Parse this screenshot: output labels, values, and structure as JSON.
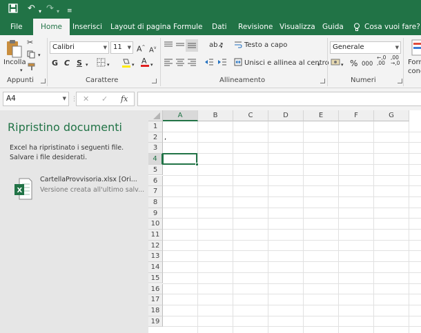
{
  "quick_access": {
    "save_icon": "save-icon",
    "undo_icon": "undo-icon",
    "redo_icon": "redo-icon",
    "customize_icon": "customize-qat-icon"
  },
  "tabs": [
    "File",
    "Home",
    "Inserisci",
    "Layout di pagina",
    "Formule",
    "Dati",
    "Revisione",
    "Visualizza",
    "Guida",
    "Cosa vuoi fare?"
  ],
  "active_tab": "Home",
  "ribbon": {
    "clipboard": {
      "paste_label": "Incolla",
      "group_label": "Appunti"
    },
    "font": {
      "font_name": "Calibri",
      "font_size": "11",
      "bold": "G",
      "italic": "C",
      "underline": "S",
      "group_label": "Carattere",
      "increase": "A",
      "decrease": "A"
    },
    "alignment": {
      "wrap_text": "Testo a capo",
      "merge_center": "Unisci e allinea al centro",
      "group_label": "Allineamento"
    },
    "number": {
      "format": "Generale",
      "percent": "%",
      "thousands": "000",
      "group_label": "Numeri"
    },
    "styles": {
      "cond_line1": "Form",
      "cond_line2": "condi"
    }
  },
  "formula_bar": {
    "name_box": "A4",
    "cancel": "✕",
    "enter": "✓",
    "fx": "fx",
    "value": ""
  },
  "recovery_pane": {
    "title": "Ripristino documenti",
    "description": "Excel ha ripristinato i seguenti file. Salvare i file desiderati.",
    "files": [
      {
        "name": "CartellaProvvisoria.xlsx  [Ori...",
        "subtitle": "Versione creata all'ultimo salv..."
      }
    ]
  },
  "sheet": {
    "columns": [
      "A",
      "B",
      "C",
      "D",
      "E",
      "F",
      "G"
    ],
    "rows": [
      "1",
      "2",
      "3",
      "4",
      "5",
      "6",
      "7",
      "8",
      "9",
      "10",
      "11",
      "12",
      "13",
      "14",
      "15",
      "16",
      "17",
      "18",
      "19"
    ],
    "active_cell": "A4",
    "cells": {
      "A2": ","
    }
  },
  "colors": {
    "accent": "#217346",
    "ribbon_bg": "#f3f3f3",
    "pane_bg": "#e6e6e6"
  }
}
